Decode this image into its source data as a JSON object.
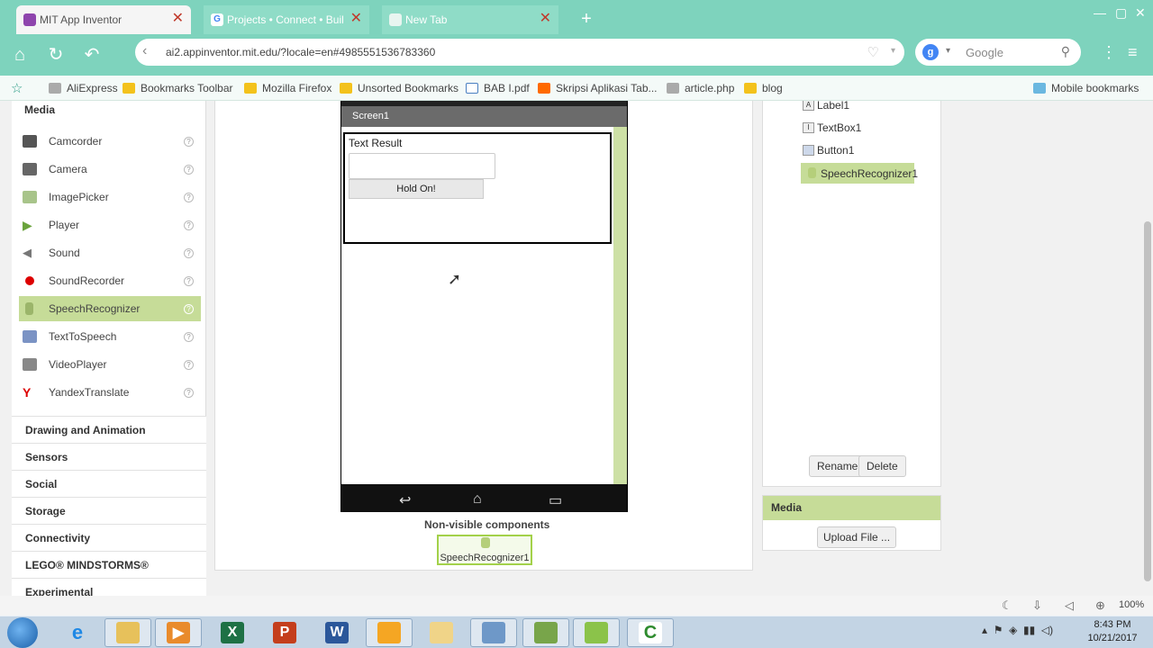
{
  "browser": {
    "tabs": [
      {
        "title": "MIT App Inventor",
        "active": true
      },
      {
        "title": "Projects • Connect • Buil",
        "active": false
      },
      {
        "title": "New Tab",
        "active": false
      }
    ],
    "url": "ai2.appinventor.mit.edu/?locale=en#4985551536783360",
    "search_placeholder": "Google",
    "bookmarks": [
      "AliExpress",
      "Bookmarks Toolbar",
      "Mozilla Firefox",
      "Unsorted Bookmarks",
      "BAB I.pdf",
      "Skripsi Aplikasi Tab...",
      "article.php",
      "blog",
      "Mobile bookmarks"
    ],
    "zoom": "100%"
  },
  "palette": {
    "section": "Media",
    "items": [
      {
        "label": "Camcorder",
        "icon": "camcorder-icon"
      },
      {
        "label": "Camera",
        "icon": "camera-icon"
      },
      {
        "label": "ImagePicker",
        "icon": "imagepicker-icon"
      },
      {
        "label": "Player",
        "icon": "player-icon"
      },
      {
        "label": "Sound",
        "icon": "sound-icon"
      },
      {
        "label": "SoundRecorder",
        "icon": "soundrecorder-icon"
      },
      {
        "label": "SpeechRecognizer",
        "icon": "speechrecognizer-icon",
        "selected": true
      },
      {
        "label": "TextToSpeech",
        "icon": "texttospeech-icon"
      },
      {
        "label": "VideoPlayer",
        "icon": "videoplayer-icon"
      },
      {
        "label": "YandexTranslate",
        "icon": "yandextranslate-icon"
      }
    ],
    "help": "?",
    "categories": [
      "Drawing and Animation",
      "Sensors",
      "Social",
      "Storage",
      "Connectivity",
      "LEGO® MINDSTORMS®",
      "Experimental"
    ]
  },
  "viewer": {
    "screen_title": "Screen1",
    "label_text": "Text Result",
    "button_text": "Hold On!",
    "nonvisible_header": "Non-visible components",
    "nonvisible_item": "SpeechRecognizer1"
  },
  "components": {
    "tree": [
      "Label1",
      "TextBox1",
      "Button1",
      "SpeechRecognizer1"
    ],
    "selected": "SpeechRecognizer1",
    "rename": "Rename",
    "delete": "Delete"
  },
  "media": {
    "header": "Media",
    "upload": "Upload File ..."
  },
  "taskbar": {
    "time": "8:43 PM",
    "date": "10/21/2017"
  }
}
